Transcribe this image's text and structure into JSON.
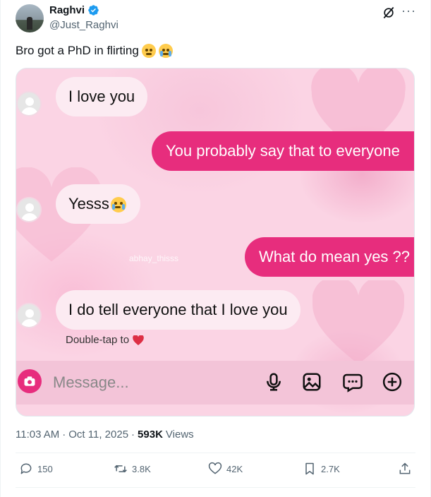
{
  "author": {
    "display_name": "Raghvi",
    "handle": "@Just_Raghvi",
    "verified": true
  },
  "tweet": {
    "text": "Bro got a PhD in flirting",
    "emojis": [
      "pleading-face",
      "loudly-crying-face"
    ]
  },
  "media": {
    "chat": [
      {
        "from": "them",
        "text": "I love you"
      },
      {
        "from": "me",
        "text": "You probably say that to everyone"
      },
      {
        "from": "them",
        "text": "Yesss"
      },
      {
        "from": "me",
        "text": "What do mean yes ??"
      },
      {
        "from": "them",
        "text": "I do tell everyone that I love you"
      }
    ],
    "watermark": "abhay_thisss",
    "reaction_hint": "Double-tap to",
    "composer_placeholder": "Message...",
    "composer_icons": [
      "camera-icon",
      "microphone-icon",
      "image-icon",
      "sticker-icon",
      "plus-icon"
    ]
  },
  "meta": {
    "time": "11:03 AM",
    "separator": "·",
    "date": "Oct 11, 2025",
    "views_count": "593K",
    "views_label": "Views"
  },
  "actions": {
    "replies": "150",
    "reposts": "3.8K",
    "likes": "42K",
    "bookmarks": "2.7K"
  },
  "colors": {
    "accent_pink": "#e72d7d",
    "verified_blue": "#1d9bf0",
    "secondary_text": "#536471"
  }
}
